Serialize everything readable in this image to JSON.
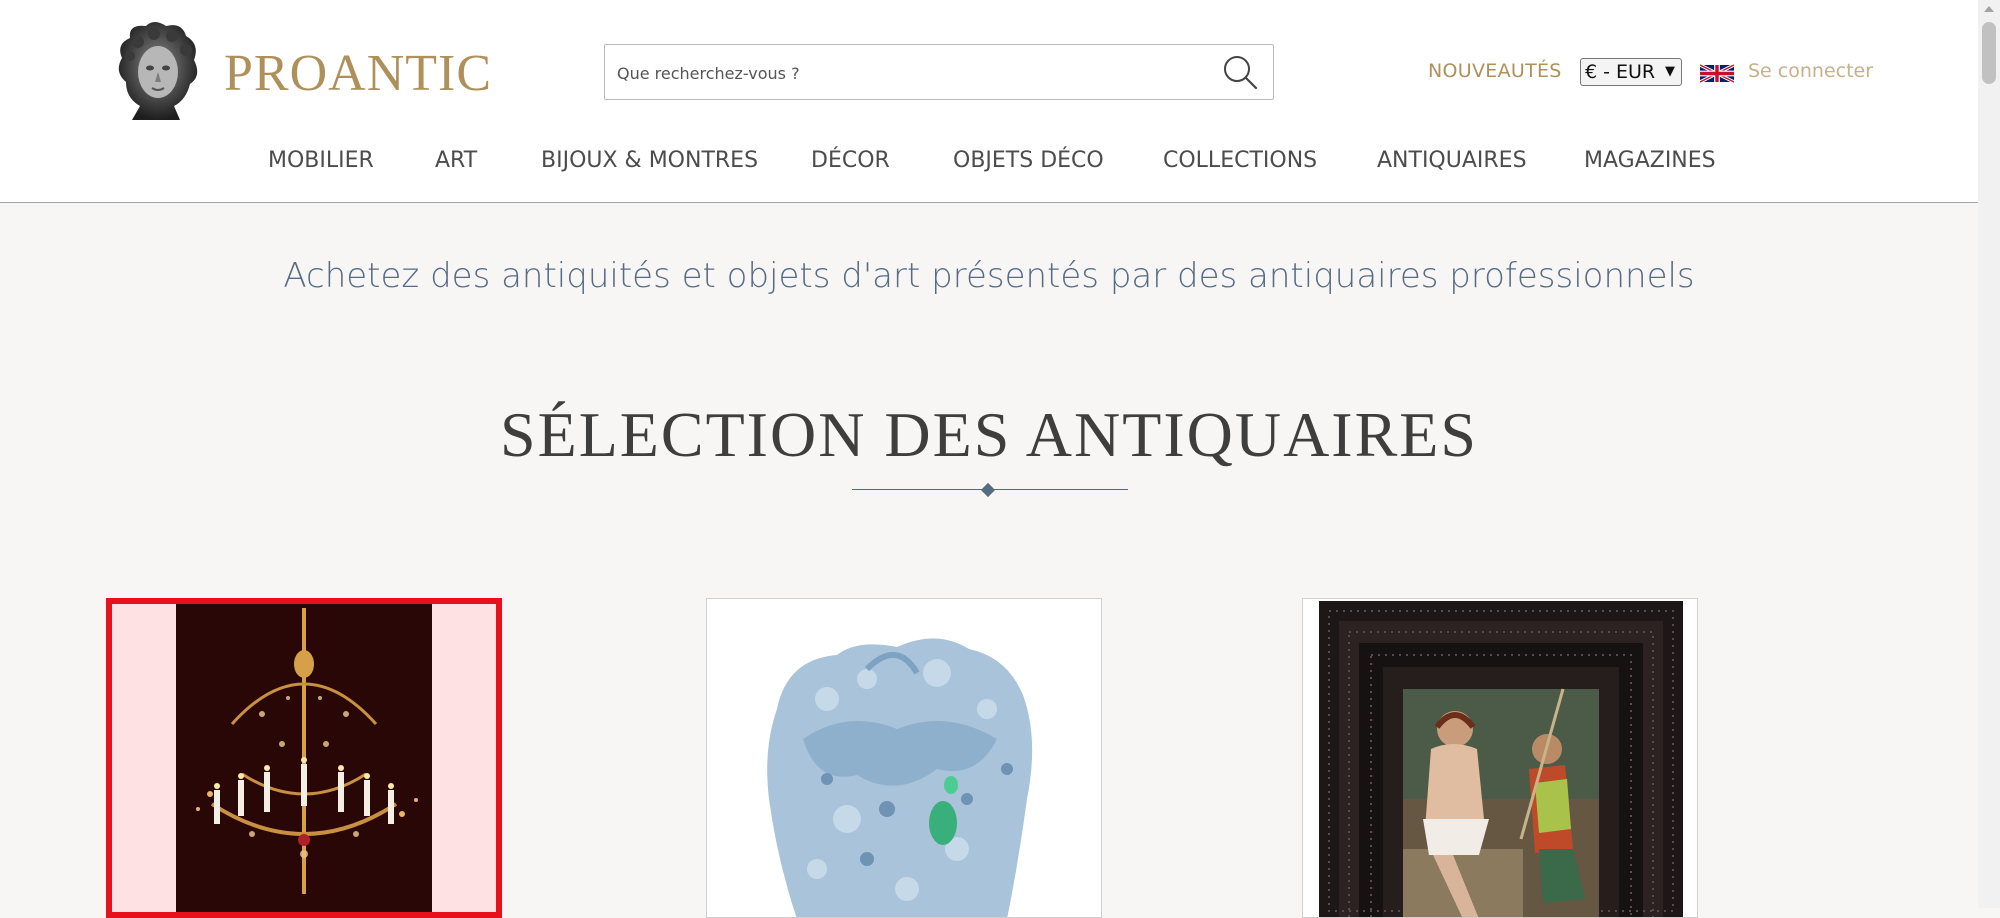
{
  "header": {
    "brand": "PROANTIC",
    "search": {
      "placeholder": "Que recherchez-vous ?"
    },
    "new_label": "NOUVEAUTÉS",
    "currency": "€ - EUR",
    "login_label": "Se connecter",
    "nav": [
      "MOBILIER",
      "ART",
      "BIJOUX & MONTRES",
      "DÉCOR",
      "OBJETS DÉCO",
      "COLLECTIONS",
      "ANTIQUAIRES",
      "MAGAZINES"
    ]
  },
  "main": {
    "tagline": "Achetez des antiquités et objets d'art présentés par des antiquaires professionnels",
    "section_title": "SÉLECTION DES ANTIQUAIRES"
  },
  "cards": [
    {
      "subject": "crystal chandelier",
      "selected": true
    },
    {
      "subject": "carved blue jade sculpture",
      "selected": false
    },
    {
      "subject": "framed religious painting",
      "selected": false
    }
  ],
  "colors": {
    "brand_gold": "#b0905a",
    "accent_slate": "#566b84",
    "selection_red": "#e8101a",
    "page_bg": "#f7f6f4"
  }
}
